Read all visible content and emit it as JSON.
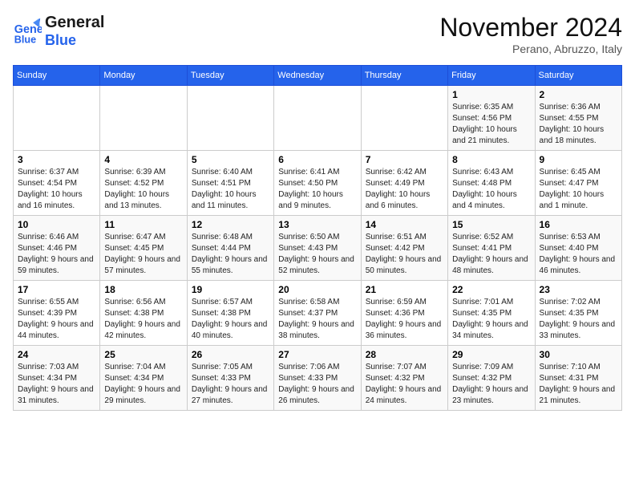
{
  "header": {
    "logo_line1": "General",
    "logo_line2": "Blue",
    "month": "November 2024",
    "location": "Perano, Abruzzo, Italy"
  },
  "weekdays": [
    "Sunday",
    "Monday",
    "Tuesday",
    "Wednesday",
    "Thursday",
    "Friday",
    "Saturday"
  ],
  "weeks": [
    [
      {
        "day": "",
        "info": ""
      },
      {
        "day": "",
        "info": ""
      },
      {
        "day": "",
        "info": ""
      },
      {
        "day": "",
        "info": ""
      },
      {
        "day": "",
        "info": ""
      },
      {
        "day": "1",
        "info": "Sunrise: 6:35 AM\nSunset: 4:56 PM\nDaylight: 10 hours and 21 minutes."
      },
      {
        "day": "2",
        "info": "Sunrise: 6:36 AM\nSunset: 4:55 PM\nDaylight: 10 hours and 18 minutes."
      }
    ],
    [
      {
        "day": "3",
        "info": "Sunrise: 6:37 AM\nSunset: 4:54 PM\nDaylight: 10 hours and 16 minutes."
      },
      {
        "day": "4",
        "info": "Sunrise: 6:39 AM\nSunset: 4:52 PM\nDaylight: 10 hours and 13 minutes."
      },
      {
        "day": "5",
        "info": "Sunrise: 6:40 AM\nSunset: 4:51 PM\nDaylight: 10 hours and 11 minutes."
      },
      {
        "day": "6",
        "info": "Sunrise: 6:41 AM\nSunset: 4:50 PM\nDaylight: 10 hours and 9 minutes."
      },
      {
        "day": "7",
        "info": "Sunrise: 6:42 AM\nSunset: 4:49 PM\nDaylight: 10 hours and 6 minutes."
      },
      {
        "day": "8",
        "info": "Sunrise: 6:43 AM\nSunset: 4:48 PM\nDaylight: 10 hours and 4 minutes."
      },
      {
        "day": "9",
        "info": "Sunrise: 6:45 AM\nSunset: 4:47 PM\nDaylight: 10 hours and 1 minute."
      }
    ],
    [
      {
        "day": "10",
        "info": "Sunrise: 6:46 AM\nSunset: 4:46 PM\nDaylight: 9 hours and 59 minutes."
      },
      {
        "day": "11",
        "info": "Sunrise: 6:47 AM\nSunset: 4:45 PM\nDaylight: 9 hours and 57 minutes."
      },
      {
        "day": "12",
        "info": "Sunrise: 6:48 AM\nSunset: 4:44 PM\nDaylight: 9 hours and 55 minutes."
      },
      {
        "day": "13",
        "info": "Sunrise: 6:50 AM\nSunset: 4:43 PM\nDaylight: 9 hours and 52 minutes."
      },
      {
        "day": "14",
        "info": "Sunrise: 6:51 AM\nSunset: 4:42 PM\nDaylight: 9 hours and 50 minutes."
      },
      {
        "day": "15",
        "info": "Sunrise: 6:52 AM\nSunset: 4:41 PM\nDaylight: 9 hours and 48 minutes."
      },
      {
        "day": "16",
        "info": "Sunrise: 6:53 AM\nSunset: 4:40 PM\nDaylight: 9 hours and 46 minutes."
      }
    ],
    [
      {
        "day": "17",
        "info": "Sunrise: 6:55 AM\nSunset: 4:39 PM\nDaylight: 9 hours and 44 minutes."
      },
      {
        "day": "18",
        "info": "Sunrise: 6:56 AM\nSunset: 4:38 PM\nDaylight: 9 hours and 42 minutes."
      },
      {
        "day": "19",
        "info": "Sunrise: 6:57 AM\nSunset: 4:38 PM\nDaylight: 9 hours and 40 minutes."
      },
      {
        "day": "20",
        "info": "Sunrise: 6:58 AM\nSunset: 4:37 PM\nDaylight: 9 hours and 38 minutes."
      },
      {
        "day": "21",
        "info": "Sunrise: 6:59 AM\nSunset: 4:36 PM\nDaylight: 9 hours and 36 minutes."
      },
      {
        "day": "22",
        "info": "Sunrise: 7:01 AM\nSunset: 4:35 PM\nDaylight: 9 hours and 34 minutes."
      },
      {
        "day": "23",
        "info": "Sunrise: 7:02 AM\nSunset: 4:35 PM\nDaylight: 9 hours and 33 minutes."
      }
    ],
    [
      {
        "day": "24",
        "info": "Sunrise: 7:03 AM\nSunset: 4:34 PM\nDaylight: 9 hours and 31 minutes."
      },
      {
        "day": "25",
        "info": "Sunrise: 7:04 AM\nSunset: 4:34 PM\nDaylight: 9 hours and 29 minutes."
      },
      {
        "day": "26",
        "info": "Sunrise: 7:05 AM\nSunset: 4:33 PM\nDaylight: 9 hours and 27 minutes."
      },
      {
        "day": "27",
        "info": "Sunrise: 7:06 AM\nSunset: 4:33 PM\nDaylight: 9 hours and 26 minutes."
      },
      {
        "day": "28",
        "info": "Sunrise: 7:07 AM\nSunset: 4:32 PM\nDaylight: 9 hours and 24 minutes."
      },
      {
        "day": "29",
        "info": "Sunrise: 7:09 AM\nSunset: 4:32 PM\nDaylight: 9 hours and 23 minutes."
      },
      {
        "day": "30",
        "info": "Sunrise: 7:10 AM\nSunset: 4:31 PM\nDaylight: 9 hours and 21 minutes."
      }
    ]
  ]
}
